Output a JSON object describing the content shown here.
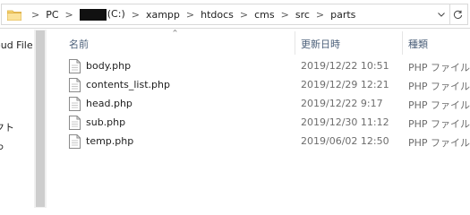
{
  "address_bar": {
    "crumbs": [
      "PC",
      "(C:)",
      "xampp",
      "htdocs",
      "cms",
      "src",
      "parts"
    ],
    "separator": ">",
    "dropdown_icon": "chevron-down-icon",
    "refresh_icon": "refresh-icon"
  },
  "nav_pane": {
    "items": [
      "oud File",
      "クト",
      "っ",
      "f"
    ]
  },
  "file_list": {
    "columns": {
      "name": "名前",
      "date": "更新日時",
      "type": "種類"
    },
    "sort_indicator": "˄",
    "files": [
      {
        "name": "body.php",
        "date": "2019/12/22 10:51",
        "type": "PHP ファイル"
      },
      {
        "name": "contents_list.php",
        "date": "2019/12/29 12:21",
        "type": "PHP ファイル"
      },
      {
        "name": "head.php",
        "date": "2019/12/22 9:17",
        "type": "PHP ファイル"
      },
      {
        "name": "sub.php",
        "date": "2019/12/30 11:12",
        "type": "PHP ファイル"
      },
      {
        "name": "temp.php",
        "date": "2019/06/02 12:50",
        "type": "PHP ファイル"
      }
    ]
  },
  "colors": {
    "header_text": "#4c607a",
    "meta_text": "#6d6d6d",
    "folder_yellow": "#f8d775"
  }
}
